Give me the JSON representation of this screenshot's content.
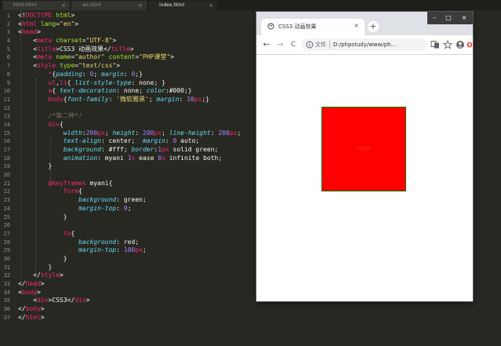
{
  "editor": {
    "tabs": [
      {
        "label": "html.html",
        "active": false
      },
      {
        "label": "ws.html",
        "active": false
      },
      {
        "label": "index.html",
        "active": true
      }
    ],
    "line_numbers": [
      "1",
      "2",
      "3",
      "4",
      "5",
      "6",
      "7",
      "8",
      "9",
      "10",
      "11",
      "12",
      "13",
      "14",
      "15",
      "16",
      "17",
      "18",
      "19",
      "20",
      "21",
      "22",
      "23",
      "24",
      "25",
      "26",
      "27",
      "28",
      "29",
      "30",
      "31",
      "32",
      "33",
      "34",
      "35",
      "36",
      "37"
    ],
    "code_lines": [
      [
        [
          "t-txt",
          "<!"
        ],
        [
          "t-tag",
          "DOCTYPE"
        ],
        [
          "t-txt",
          " "
        ],
        [
          "t-attr",
          "html"
        ],
        [
          "t-txt",
          ">"
        ]
      ],
      [
        [
          "t-txt",
          "<"
        ],
        [
          "t-tag",
          "html"
        ],
        [
          "t-txt",
          " "
        ],
        [
          "t-attr",
          "lang"
        ],
        [
          "t-txt",
          "="
        ],
        [
          "t-str",
          "\"en\""
        ],
        [
          "t-txt",
          ">"
        ]
      ],
      [
        [
          "t-txt",
          "<"
        ],
        [
          "t-tag",
          "head"
        ],
        [
          "t-txt",
          ">"
        ]
      ],
      [
        [
          "t-txt",
          "    <"
        ],
        [
          "t-tag",
          "meta"
        ],
        [
          "t-txt",
          " "
        ],
        [
          "t-attr",
          "charset"
        ],
        [
          "t-txt",
          "="
        ],
        [
          "t-str",
          "\"UTF-8\""
        ],
        [
          "t-txt",
          ">"
        ]
      ],
      [
        [
          "t-txt",
          "    <"
        ],
        [
          "t-tag",
          "title"
        ],
        [
          "t-txt",
          ">CSS3 动画效果</"
        ],
        [
          "t-tag",
          "title"
        ],
        [
          "t-txt",
          ">"
        ]
      ],
      [
        [
          "t-txt",
          "    <"
        ],
        [
          "t-tag",
          "meta"
        ],
        [
          "t-txt",
          " "
        ],
        [
          "t-attr",
          "name"
        ],
        [
          "t-txt",
          "="
        ],
        [
          "t-str",
          "\"author\""
        ],
        [
          "t-txt",
          " "
        ],
        [
          "t-attr",
          "content"
        ],
        [
          "t-txt",
          "="
        ],
        [
          "t-str",
          "\"PHP课堂\""
        ],
        [
          "t-txt",
          ">"
        ]
      ],
      [
        [
          "t-txt",
          "    <"
        ],
        [
          "t-tag",
          "style"
        ],
        [
          "t-txt",
          " "
        ],
        [
          "t-attr",
          "type"
        ],
        [
          "t-txt",
          "="
        ],
        [
          "t-str",
          "\"text/css\""
        ],
        [
          "t-txt",
          ">"
        ]
      ],
      [
        [
          "t-txt",
          "        "
        ],
        [
          "t-tag",
          "*"
        ],
        [
          "t-txt",
          "{"
        ],
        [
          "t-kw",
          "padding"
        ],
        [
          "t-txt",
          ": "
        ],
        [
          "t-num",
          "0"
        ],
        [
          "t-txt",
          "; "
        ],
        [
          "t-kw",
          "margin"
        ],
        [
          "t-txt",
          ": "
        ],
        [
          "t-num",
          "0"
        ],
        [
          "t-txt",
          ";}"
        ]
      ],
      [
        [
          "t-txt",
          "        "
        ],
        [
          "t-tag",
          "ul"
        ],
        [
          "t-txt",
          ","
        ],
        [
          "t-tag",
          "li"
        ],
        [
          "t-txt",
          "{ "
        ],
        [
          "t-kw",
          "list-style-type"
        ],
        [
          "t-txt",
          ": "
        ],
        [
          "t-txt",
          "none"
        ],
        [
          "t-txt",
          "; }"
        ]
      ],
      [
        [
          "t-txt",
          "        "
        ],
        [
          "t-tag",
          "a"
        ],
        [
          "t-txt",
          "{ "
        ],
        [
          "t-kw",
          "text-decoration"
        ],
        [
          "t-txt",
          ": none; "
        ],
        [
          "t-kw",
          "color"
        ],
        [
          "t-txt",
          ":"
        ],
        [
          "t-txt",
          "#000"
        ],
        [
          "t-txt",
          ";}"
        ]
      ],
      [
        [
          "t-txt",
          "        "
        ],
        [
          "t-tag",
          "body"
        ],
        [
          "t-txt",
          "{"
        ],
        [
          "t-kw",
          "font-family"
        ],
        [
          "t-txt",
          ": "
        ],
        [
          "t-str",
          "'微软雅黑'"
        ],
        [
          "t-txt",
          "; "
        ],
        [
          "t-kw",
          "margin"
        ],
        [
          "t-txt",
          ": "
        ],
        [
          "t-num",
          "10"
        ],
        [
          "t-tag",
          "px"
        ],
        [
          "t-txt",
          ";}"
        ]
      ],
      [
        [
          "t-txt",
          ""
        ]
      ],
      [
        [
          "t-txt",
          "        "
        ],
        [
          "t-com",
          "/*第二种*/"
        ]
      ],
      [
        [
          "t-txt",
          "        "
        ],
        [
          "t-tag",
          "div"
        ],
        [
          "t-txt",
          "{"
        ]
      ],
      [
        [
          "t-txt",
          "            "
        ],
        [
          "t-kw",
          "width"
        ],
        [
          "t-txt",
          ":"
        ],
        [
          "t-num",
          "200"
        ],
        [
          "t-tag",
          "px"
        ],
        [
          "t-txt",
          "; "
        ],
        [
          "t-kw",
          "height"
        ],
        [
          "t-txt",
          ": "
        ],
        [
          "t-num",
          "200"
        ],
        [
          "t-tag",
          "px"
        ],
        [
          "t-txt",
          "; "
        ],
        [
          "t-kw",
          "line-height"
        ],
        [
          "t-txt",
          ": "
        ],
        [
          "t-num",
          "200"
        ],
        [
          "t-tag",
          "px"
        ],
        [
          "t-txt",
          ";"
        ]
      ],
      [
        [
          "t-txt",
          "            "
        ],
        [
          "t-kw",
          "text-align"
        ],
        [
          "t-txt",
          ": center;  "
        ],
        [
          "t-kw",
          "margin"
        ],
        [
          "t-txt",
          ": "
        ],
        [
          "t-num",
          "0"
        ],
        [
          "t-txt",
          " auto;"
        ]
      ],
      [
        [
          "t-txt",
          "            "
        ],
        [
          "t-kw",
          "background"
        ],
        [
          "t-txt",
          ": "
        ],
        [
          "t-txt",
          "#fff"
        ],
        [
          "t-txt",
          "; "
        ],
        [
          "t-kw",
          "border"
        ],
        [
          "t-txt",
          ":"
        ],
        [
          "t-num",
          "1"
        ],
        [
          "t-tag",
          "px"
        ],
        [
          "t-txt",
          " solid green;"
        ]
      ],
      [
        [
          "t-txt",
          "            "
        ],
        [
          "t-kw",
          "animation"
        ],
        [
          "t-txt",
          ": myani "
        ],
        [
          "t-num",
          "1"
        ],
        [
          "t-tag",
          "s"
        ],
        [
          "t-txt",
          " ease "
        ],
        [
          "t-num",
          "0"
        ],
        [
          "t-tag",
          "s"
        ],
        [
          "t-txt",
          " infinite both;"
        ]
      ],
      [
        [
          "t-txt",
          "        }"
        ]
      ],
      [
        [
          "t-txt",
          ""
        ]
      ],
      [
        [
          "t-txt",
          "        "
        ],
        [
          "t-at",
          "@keyframes"
        ],
        [
          "t-txt",
          " myani{"
        ]
      ],
      [
        [
          "t-txt",
          "            "
        ],
        [
          "t-tag",
          "form"
        ],
        [
          "t-txt",
          "{"
        ]
      ],
      [
        [
          "t-txt",
          "                "
        ],
        [
          "t-kw",
          "background"
        ],
        [
          "t-txt",
          ": green;"
        ]
      ],
      [
        [
          "t-txt",
          "                "
        ],
        [
          "t-kw",
          "margin-top"
        ],
        [
          "t-txt",
          ": "
        ],
        [
          "t-num",
          "0"
        ],
        [
          "t-txt",
          ";"
        ]
      ],
      [
        [
          "t-txt",
          "            }"
        ]
      ],
      [
        [
          "t-txt",
          ""
        ]
      ],
      [
        [
          "t-txt",
          "            "
        ],
        [
          "t-tag",
          "to"
        ],
        [
          "t-txt",
          "{"
        ]
      ],
      [
        [
          "t-txt",
          "                "
        ],
        [
          "t-kw",
          "background"
        ],
        [
          "t-txt",
          ": red;"
        ]
      ],
      [
        [
          "t-txt",
          "                "
        ],
        [
          "t-kw",
          "margin-top"
        ],
        [
          "t-txt",
          ": "
        ],
        [
          "t-num",
          "100"
        ],
        [
          "t-tag",
          "px"
        ],
        [
          "t-txt",
          ";"
        ]
      ],
      [
        [
          "t-txt",
          "            }"
        ]
      ],
      [
        [
          "t-txt",
          "        }"
        ]
      ],
      [
        [
          "t-txt",
          "    </"
        ],
        [
          "t-tag",
          "style"
        ],
        [
          "t-txt",
          ">"
        ]
      ],
      [
        [
          "t-txt",
          "</"
        ],
        [
          "t-tag",
          "head"
        ],
        [
          "t-txt",
          ">"
        ]
      ],
      [
        [
          "t-txt",
          "<"
        ],
        [
          "t-tag",
          "body"
        ],
        [
          "t-txt",
          ">"
        ]
      ],
      [
        [
          "t-txt",
          "    <"
        ],
        [
          "t-tag",
          "div"
        ],
        [
          "t-txt",
          ">CSS3</"
        ],
        [
          "t-tag",
          "div"
        ],
        [
          "t-txt",
          ">"
        ]
      ],
      [
        [
          "t-txt",
          "</"
        ],
        [
          "t-tag",
          "body"
        ],
        [
          "t-txt",
          ">"
        ]
      ],
      [
        [
          "t-txt",
          "</"
        ],
        [
          "t-tag",
          "html"
        ],
        [
          "t-txt",
          ">"
        ]
      ]
    ]
  },
  "browser": {
    "tab_title": "CSS3 动画效果",
    "tab_close": "×",
    "new_tab": "+",
    "window_controls": [
      "–",
      "□",
      "×"
    ],
    "nav": {
      "back": "←",
      "forward": "→",
      "reload": "C"
    },
    "omnibox": {
      "label": "文件",
      "url": "D:/phpstudy/www/ph..."
    },
    "toolbar_icons": [
      "translate-icon",
      "star-icon",
      "profile-icon",
      "extension-icon"
    ],
    "page": {
      "box_text": "CSS3",
      "box_color": "#ff0000"
    }
  }
}
